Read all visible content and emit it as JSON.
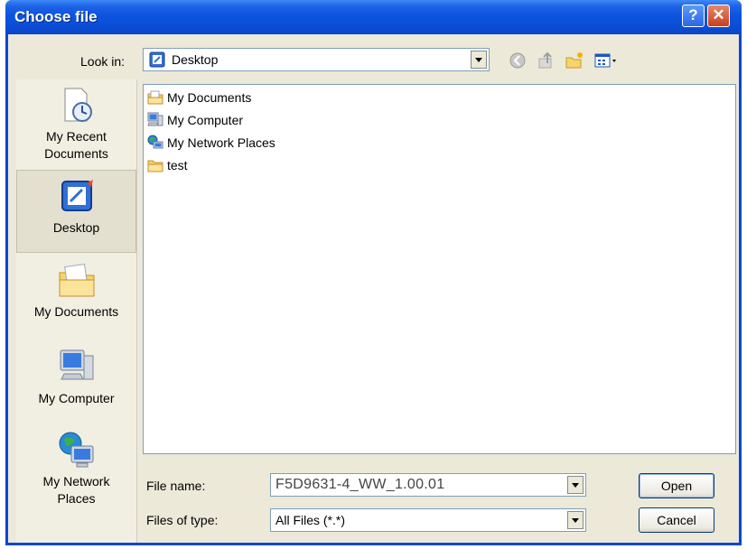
{
  "dialog": {
    "title": "Choose file",
    "help_glyph": "?",
    "close_glyph": "✕"
  },
  "lookin": {
    "label": "Look in:",
    "value": "Desktop"
  },
  "toolbar": {
    "icons": [
      "back-icon",
      "up-folder-icon",
      "new-folder-icon",
      "view-menu-icon"
    ]
  },
  "places": [
    {
      "label": "My Recent Documents",
      "line1": "My Recent",
      "line2": "Documents",
      "icon": "recent-documents-icon"
    },
    {
      "label": "Desktop",
      "line1": "Desktop",
      "line2": "",
      "icon": "desktop-icon",
      "selected": true
    },
    {
      "label": "My Documents",
      "line1": "My Documents",
      "line2": "",
      "icon": "my-documents-icon"
    },
    {
      "label": "My Computer",
      "line1": "My Computer",
      "line2": "",
      "icon": "my-computer-icon"
    },
    {
      "label": "My Network Places",
      "line1": "My Network",
      "line2": "Places",
      "icon": "network-places-icon"
    }
  ],
  "files": [
    {
      "label": "My Documents",
      "icon": "my-documents-icon"
    },
    {
      "label": "My Computer",
      "icon": "my-computer-icon"
    },
    {
      "label": "My Network Places",
      "icon": "network-places-icon"
    },
    {
      "label": "test",
      "icon": "folder-icon"
    }
  ],
  "filename": {
    "label": "File name:",
    "value": "F5D9631-4_WW_1.00.01"
  },
  "filetype": {
    "label": "Files of type:",
    "value": "All Files (*.*)"
  },
  "buttons": {
    "open": "Open",
    "cancel": "Cancel"
  },
  "colors": {
    "title_bar": "#0a4fd8",
    "dialog_face": "#ece9d8",
    "field_border": "#7f9db9"
  }
}
